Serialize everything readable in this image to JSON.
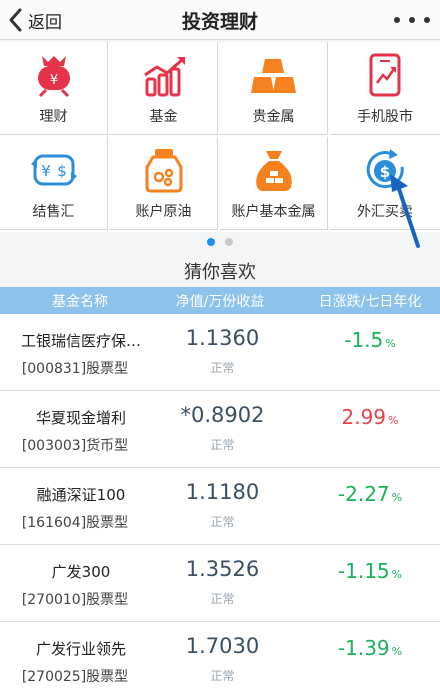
{
  "header": {
    "back_label": "返回",
    "title": "投资理财"
  },
  "grid": {
    "items": [
      {
        "label": "理财",
        "icon": "wealth-bag-icon"
      },
      {
        "label": "基金",
        "icon": "fund-bars-icon"
      },
      {
        "label": "贵金属",
        "icon": "gold-bars-icon"
      },
      {
        "label": "手机股市",
        "icon": "mobile-stock-icon"
      },
      {
        "label": "结售汇",
        "icon": "currency-exchange-icon"
      },
      {
        "label": "账户原油",
        "icon": "crude-oil-icon"
      },
      {
        "label": "账户基本金属",
        "icon": "base-metal-bag-icon"
      },
      {
        "label": "外汇买卖",
        "icon": "forex-dollar-icon"
      }
    ]
  },
  "pager": {
    "pages": 2,
    "active": 1
  },
  "section": {
    "title": "猜你喜欢"
  },
  "table": {
    "headers": [
      "基金名称",
      "净值/万份收益",
      "日涨跌/七日年化"
    ],
    "rows": [
      {
        "name": "工银瑞信医疗保…",
        "code": "[000831]股票型",
        "nav": "1.1360",
        "status": "正常",
        "change": "-1.5",
        "unit": "%",
        "trend": "down"
      },
      {
        "name": "华夏现金增利",
        "code": "[003003]货币型",
        "nav": "*0.8902",
        "status": "正常",
        "change": "2.99",
        "unit": "%",
        "trend": "up"
      },
      {
        "name": "融通深证100",
        "code": "[161604]股票型",
        "nav": "1.1180",
        "status": "正常",
        "change": "-2.27",
        "unit": "%",
        "trend": "down"
      },
      {
        "name": "广发300",
        "code": "[270010]股票型",
        "nav": "1.3526",
        "status": "正常",
        "change": "-1.15",
        "unit": "%",
        "trend": "down"
      },
      {
        "name": "广发行业领先",
        "code": "[270025]股票型",
        "nav": "1.7030",
        "status": "正常",
        "change": "-1.39",
        "unit": "%",
        "trend": "down"
      }
    ]
  },
  "colors": {
    "primary_red": "#e6334a",
    "orange": "#f5811f",
    "blue": "#2a8fd8",
    "up": "#e8404a",
    "down": "#19b35a",
    "table_header": "#8dc2ed"
  }
}
